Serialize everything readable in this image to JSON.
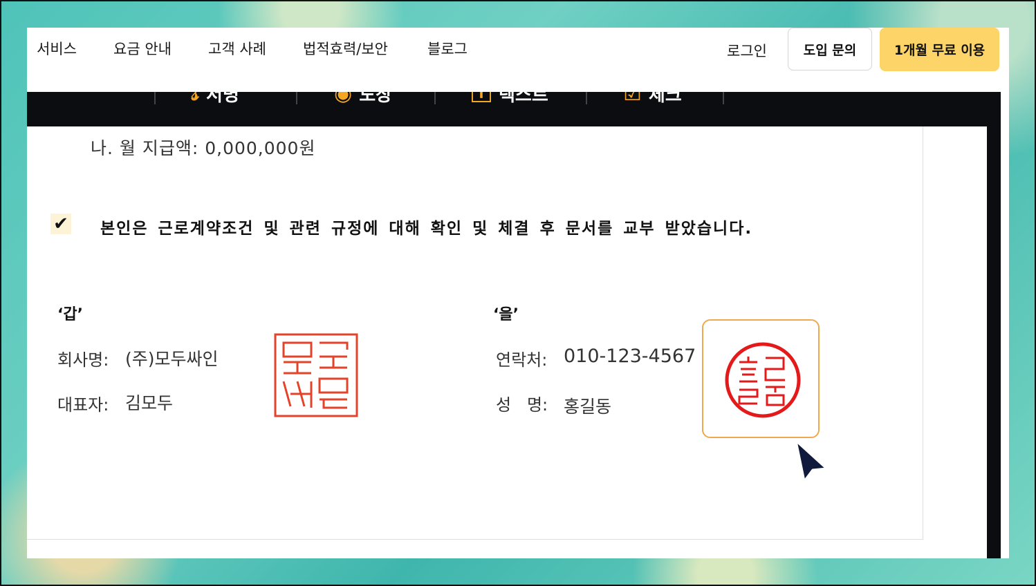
{
  "nav": {
    "items": [
      "서비스",
      "요금 안내",
      "고객 사례",
      "법적효력/보안",
      "블로그"
    ],
    "login": "로그인",
    "inquiry": "도입 문의",
    "trial": "1개월 무료 이용"
  },
  "toolbar": {
    "tools": [
      {
        "label": "서명",
        "icon": "signature-icon"
      },
      {
        "label": "도장",
        "icon": "stamp-icon"
      },
      {
        "label": "텍스트",
        "icon": "text-box-icon"
      },
      {
        "label": "체크",
        "icon": "checkbox-icon"
      }
    ]
  },
  "doc": {
    "pay_line": "나. 월 지급액: 0,000,000원",
    "agree_checked": true,
    "agree_text": "본인은 근로계약조건 및 관련 규정에 대해 확인 및 체결 후 문서를 교부 받았습니다.",
    "party_a": {
      "label": "‘갑’",
      "company_label": "회사명:",
      "company_value": "(주)모두싸인",
      "rep_label": "대표자:",
      "rep_value": "김모두",
      "seal_text": "모두싸인"
    },
    "party_b": {
      "label": "‘을’",
      "contact_label": "연락처:",
      "contact_value": "010-123-4567",
      "name_label": "성   명:",
      "name_value": "홍길동",
      "seal_text": "홍길동"
    }
  },
  "colors": {
    "brand_yellow": "#fdd467",
    "seal_red": "#e4432a",
    "highlight_orange": "#f0a84e",
    "toolbar_dark": "#0c0d10",
    "cursor_navy": "#0f1a3c"
  }
}
